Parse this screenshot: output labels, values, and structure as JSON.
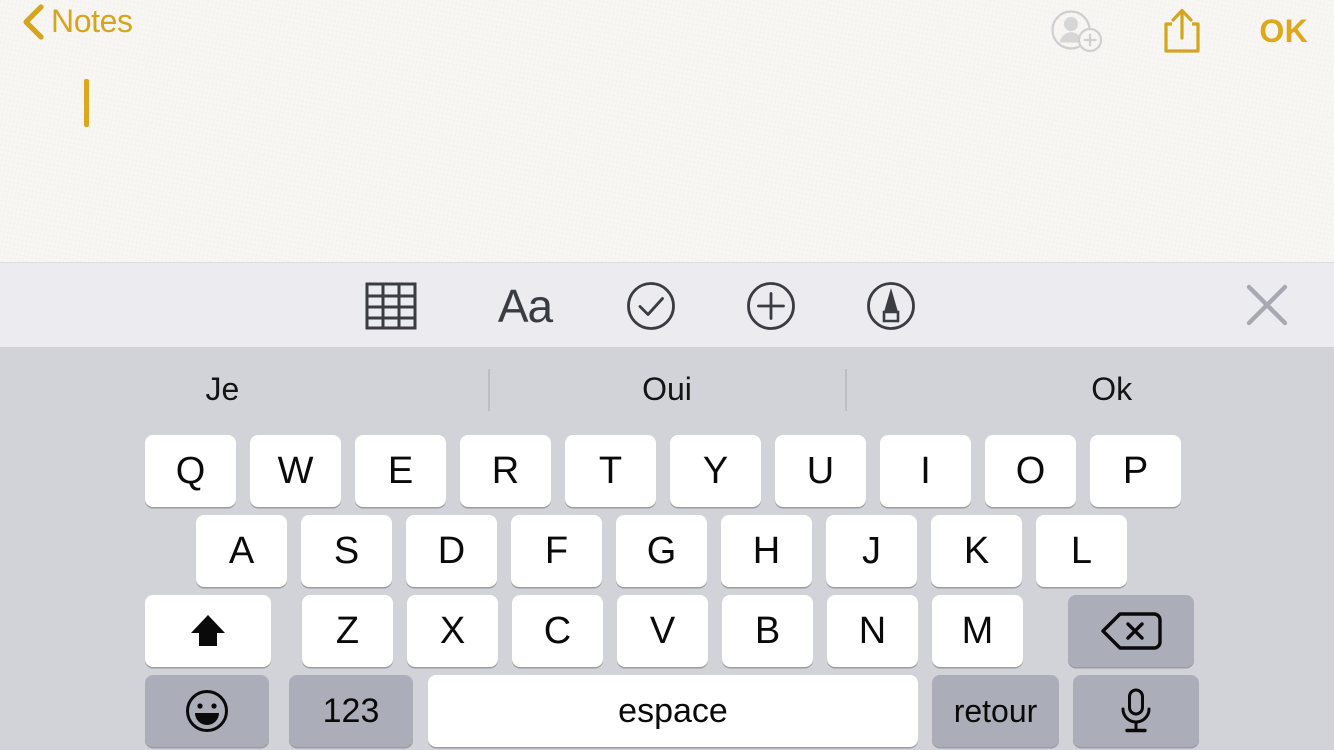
{
  "navbar": {
    "back_label": "Notes",
    "back_icon": "chevron-left-icon",
    "add_person_icon": "add-person-icon",
    "share_icon": "share-icon",
    "done_label": "OK"
  },
  "note": {
    "text": "",
    "caret_visible": true
  },
  "format_toolbar": {
    "items": [
      {
        "name": "table-icon",
        "label": "",
        "type": "icon"
      },
      {
        "name": "format-text-icon",
        "label": "Aa",
        "type": "text"
      },
      {
        "name": "checklist-icon",
        "label": "",
        "type": "icon"
      },
      {
        "name": "add-media-icon",
        "label": "",
        "type": "icon"
      },
      {
        "name": "markup-pen-icon",
        "label": "",
        "type": "icon"
      }
    ],
    "close_icon": "close-icon"
  },
  "keyboard": {
    "language": "fr",
    "predictions": [
      "Je",
      "Oui",
      "Ok"
    ],
    "row1": [
      "Q",
      "W",
      "E",
      "R",
      "T",
      "Y",
      "U",
      "I",
      "O",
      "P"
    ],
    "row2": [
      "A",
      "S",
      "D",
      "F",
      "G",
      "H",
      "J",
      "K",
      "L"
    ],
    "row3": [
      "Z",
      "X",
      "C",
      "V",
      "B",
      "N",
      "M"
    ],
    "shift_icon": "shift-arrow-icon",
    "backspace_icon": "backspace-delete-icon",
    "emoji_icon": "emoji-smiley-icon",
    "numbers_label": "123",
    "space_label": "espace",
    "return_label": "retour",
    "mic_icon": "microphone-icon"
  },
  "colors": {
    "accent_gold": "#d5a520",
    "note_paper": "#f8f7f4",
    "toolbar_bg": "#ebebf0",
    "keyboard_bg": "#d1d3d9",
    "key_light": "#ffffff",
    "key_dark": "#abaeb8"
  }
}
